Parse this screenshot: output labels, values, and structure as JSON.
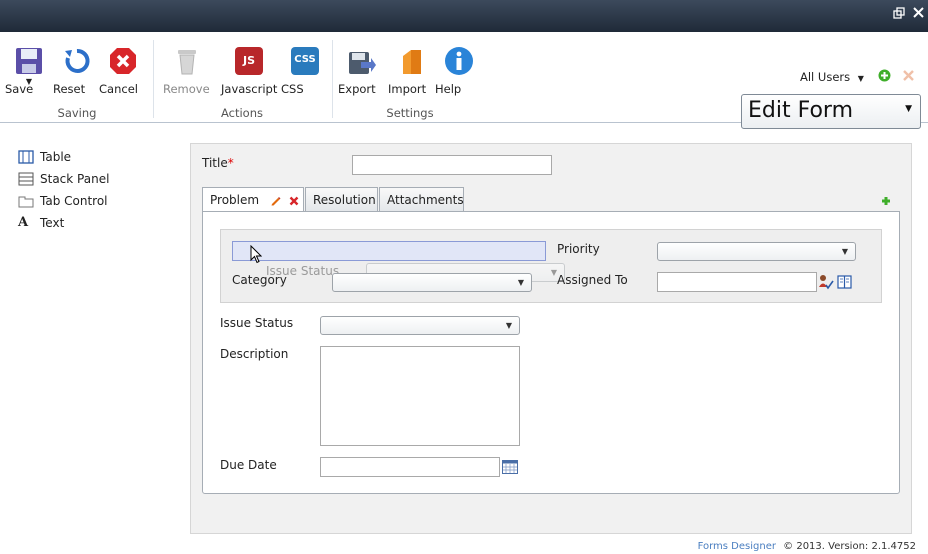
{
  "window": {
    "restore_icon": "restore-window-icon",
    "close_icon": "close-icon"
  },
  "ribbon": {
    "groups": {
      "saving": "Saving",
      "actions": "Actions",
      "settings": "Settings"
    },
    "buttons": {
      "save": "Save",
      "reset": "Reset",
      "cancel": "Cancel",
      "remove": "Remove",
      "javascript": "Javascript",
      "css": "CSS",
      "export": "Export",
      "import": "Import",
      "help": "Help"
    },
    "icon_text": {
      "js": "JS",
      "css": "CSS"
    }
  },
  "users_filter": {
    "label": "All Users"
  },
  "view_select": {
    "value": "Edit Form"
  },
  "toolbox": {
    "items": [
      {
        "label": "Table",
        "icon": "table-icon"
      },
      {
        "label": "Stack Panel",
        "icon": "stack-panel-icon"
      },
      {
        "label": "Tab Control",
        "icon": "tab-control-icon"
      },
      {
        "label": "Text",
        "icon": "text-icon"
      }
    ]
  },
  "form": {
    "title_label": "Title",
    "required_mark": "*",
    "tabs": [
      "Problem",
      "Resolution",
      "Attachments"
    ],
    "stack": {
      "priority_label": "Priority",
      "category_label": "Category",
      "assigned_to_label": "Assigned To",
      "ghost_label": "Issue Status"
    },
    "issue_status_label": "Issue Status",
    "description_label": "Description",
    "due_date_label": "Due Date"
  },
  "footer": {
    "link": "Forms Designer",
    "text": "© 2013. Version: 2.1.4752"
  },
  "colors": {
    "top_bar": "#2a3646",
    "required": "#dd0000",
    "add_green": "#3fae2a",
    "remove_red": "#d8262a"
  }
}
